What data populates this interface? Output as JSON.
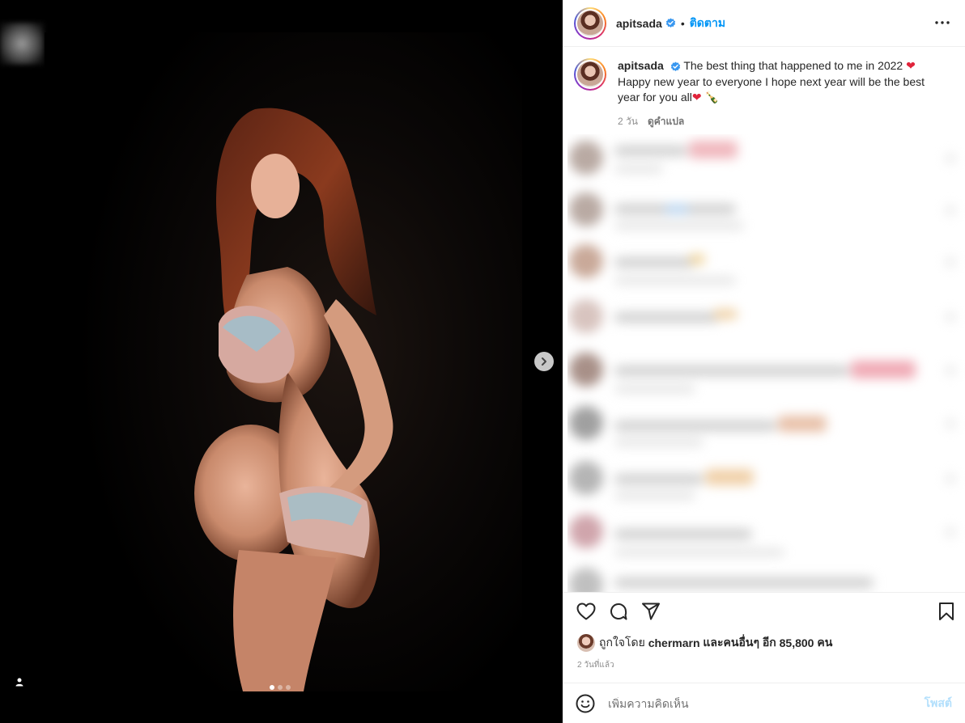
{
  "media": {
    "slide_count": 3,
    "active_slide": 1,
    "next_icon": "chevron-right-icon",
    "tag_icon": "user-tag-icon"
  },
  "header": {
    "username": "apitsada",
    "verified": true,
    "separator": "•",
    "follow_label": "ติดตาม",
    "more_icon": "more-horizontal-icon"
  },
  "caption": {
    "username": "apitsada",
    "text_line1": "The best thing that happened to me in 2022",
    "text_line2": "Happy new year to everyone I hope next year will be the best",
    "text_line3": "year for you all",
    "emoji1": "❤",
    "emoji2": "❤",
    "emoji3": "🍾",
    "age": "2 วัน",
    "translate_label": "ดูคำแปล"
  },
  "actions": {
    "like_icon": "heart-icon",
    "comment_icon": "comment-icon",
    "share_icon": "share-icon",
    "save_icon": "bookmark-icon"
  },
  "likes": {
    "prefix": "ถูกใจโดย",
    "liker": "chermarn",
    "middle": "และคนอื่นๆ อีก",
    "count": "85,800",
    "suffix": "คน"
  },
  "post_time": "2 วันที่แล้ว",
  "add_comment": {
    "emoji_icon": "smiley-icon",
    "placeholder": "เพิ่มความคิดเห็น",
    "post_label": "โพสต์"
  },
  "colors": {
    "accent": "#0095f6",
    "post_disabled": "#b2dffc",
    "muted_text": "#8e8e8e",
    "verified_badge": "#3897f0"
  }
}
